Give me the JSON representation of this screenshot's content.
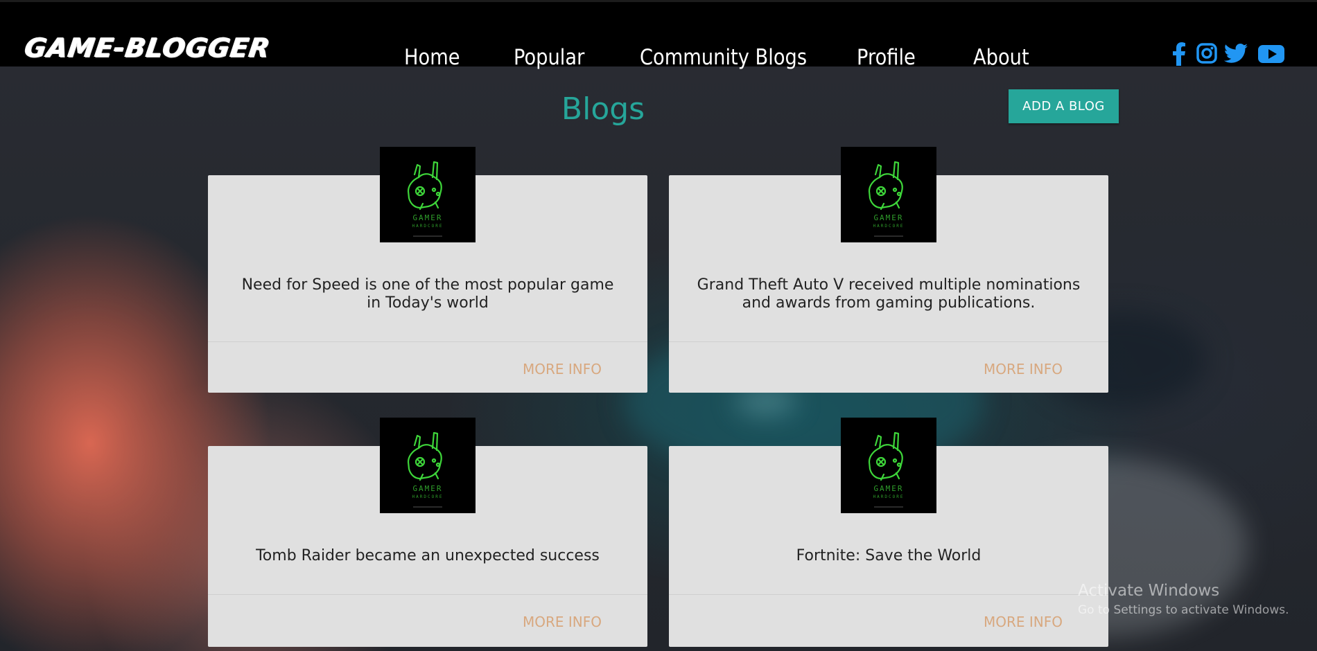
{
  "brand": {
    "logo_text": "GAME-BLOGGER"
  },
  "nav": {
    "items": [
      {
        "label": "Home"
      },
      {
        "label": "Popular"
      },
      {
        "label": "Community Blogs"
      },
      {
        "label": "Profile"
      },
      {
        "label": "About"
      }
    ]
  },
  "social": {
    "color": "#2196f3",
    "icons": [
      "facebook-icon",
      "instagram-icon",
      "twitter-icon",
      "youtube-icon"
    ]
  },
  "main": {
    "title": "Blogs",
    "title_color": "#26a69a",
    "add_button_label": "ADD A BLOG",
    "cards": [
      {
        "thumb_caption": "GAMER",
        "thumb_subcaption": "HARDCORE",
        "text": "Need for Speed is one of the most popular game in Today's world",
        "action": "MORE INFO"
      },
      {
        "thumb_caption": "GAMER",
        "thumb_subcaption": "HARDCORE",
        "text": "Grand Theft Auto V received multiple nominations and awards from gaming publications.",
        "action": "MORE INFO"
      },
      {
        "thumb_caption": "GAMER",
        "thumb_subcaption": "HARDCORE",
        "text": "Tomb Raider became an unexpected success",
        "action": "MORE INFO"
      },
      {
        "thumb_caption": "GAMER",
        "thumb_subcaption": "HARDCORE",
        "text": "Fortnite: Save the World",
        "action": "MORE INFO"
      }
    ],
    "action_color": "#d8a87f",
    "thumb_icon_color": "#3ed63a"
  },
  "watermark": {
    "title": "Activate Windows",
    "subtitle": "Go to Settings to activate Windows."
  }
}
